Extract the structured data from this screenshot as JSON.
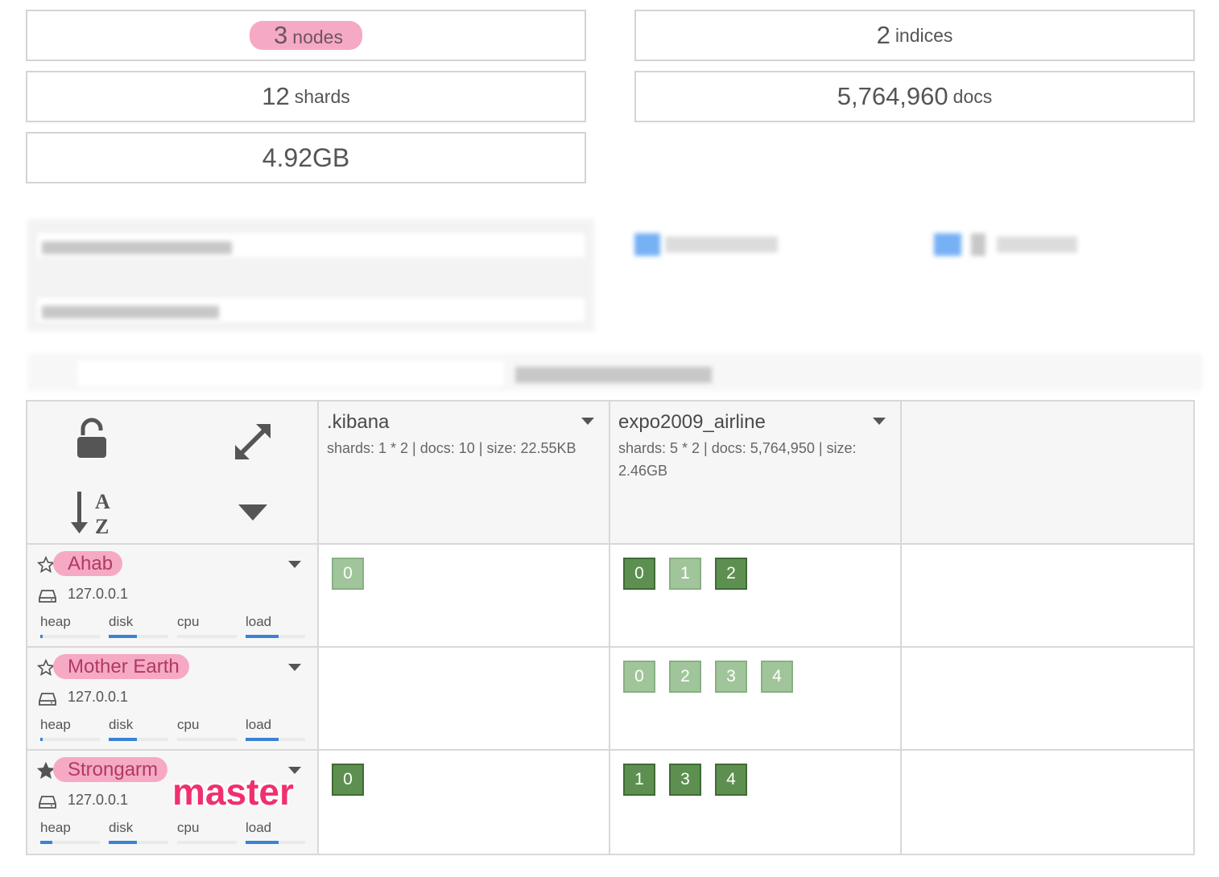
{
  "stats": {
    "nodes": {
      "value": "3",
      "unit": "nodes"
    },
    "indices": {
      "value": "2",
      "unit": "indices"
    },
    "shards": {
      "value": "12",
      "unit": "shards"
    },
    "docs": {
      "value": "5,764,960",
      "unit": "docs"
    },
    "size": {
      "value": "4.92GB"
    }
  },
  "controls": {
    "lock_icon": "unlock-icon",
    "expand_icon": "expand-icon",
    "sort_icon": "sort-az-icon",
    "menu_icon": "caret-down-icon"
  },
  "indices": [
    {
      "name": ".kibana",
      "info": "shards: 1 * 2 | docs: 10 | size: 22.55KB"
    },
    {
      "name": "expo2009_airline",
      "info": "shards: 5 * 2 | docs: 5,764,950 | size: 2.46GB"
    }
  ],
  "metric_labels": [
    "heap",
    "disk",
    "cpu",
    "load"
  ],
  "nodes": [
    {
      "name": "Ahab",
      "ip": "127.0.0.1",
      "is_master": false,
      "metrics": {
        "heap": 0.04,
        "disk": 0.47,
        "cpu": 0.0,
        "load": 0.55
      },
      "kibana_shards": [
        {
          "n": "0",
          "primary": false
        }
      ],
      "airline_shards": [
        {
          "n": "0",
          "primary": true
        },
        {
          "n": "1",
          "primary": false
        },
        {
          "n": "2",
          "primary": true
        }
      ]
    },
    {
      "name": "Mother Earth",
      "ip": "127.0.0.1",
      "is_master": false,
      "metrics": {
        "heap": 0.04,
        "disk": 0.47,
        "cpu": 0.0,
        "load": 0.55
      },
      "kibana_shards": [],
      "airline_shards": [
        {
          "n": "0",
          "primary": false
        },
        {
          "n": "2",
          "primary": false
        },
        {
          "n": "3",
          "primary": false
        },
        {
          "n": "4",
          "primary": false
        }
      ]
    },
    {
      "name": "Strongarm",
      "ip": "127.0.0.1",
      "is_master": true,
      "metrics": {
        "heap": 0.2,
        "disk": 0.47,
        "cpu": 0.0,
        "load": 0.55
      },
      "kibana_shards": [
        {
          "n": "0",
          "primary": true
        }
      ],
      "airline_shards": [
        {
          "n": "1",
          "primary": true
        },
        {
          "n": "3",
          "primary": true
        },
        {
          "n": "4",
          "primary": true
        }
      ]
    }
  ],
  "annotation": "master",
  "colors": {
    "highlight": "#f6a9c5",
    "primary_shard": "#5d9050",
    "replica_shard": "#a1c59a",
    "annotation": "#f0306e",
    "metric_fill": "#3a82d6"
  }
}
